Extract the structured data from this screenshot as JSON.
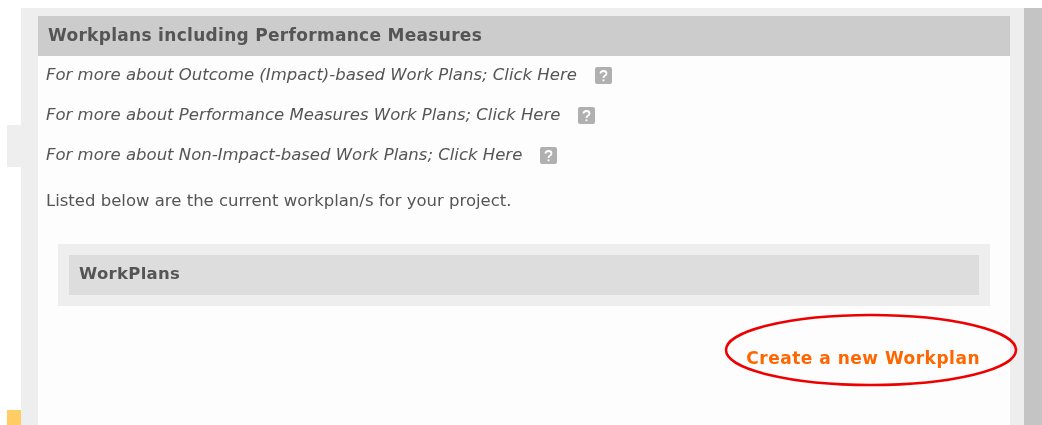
{
  "section": {
    "title": "Workplans including Performance Measures",
    "help_links": [
      {
        "text": "For more about Outcome (Impact)-based Work Plans; Click Here"
      },
      {
        "text": "For more about Performance Measures Work Plans; Click Here"
      },
      {
        "text": "For more about Non-Impact-based Work Plans; Click Here"
      }
    ],
    "intro": "Listed below are the current workplan/s for your project.",
    "workplans": {
      "title": "WorkPlans"
    },
    "create_link": {
      "text": "Create a new Workplan",
      "highlighted": true
    }
  }
}
